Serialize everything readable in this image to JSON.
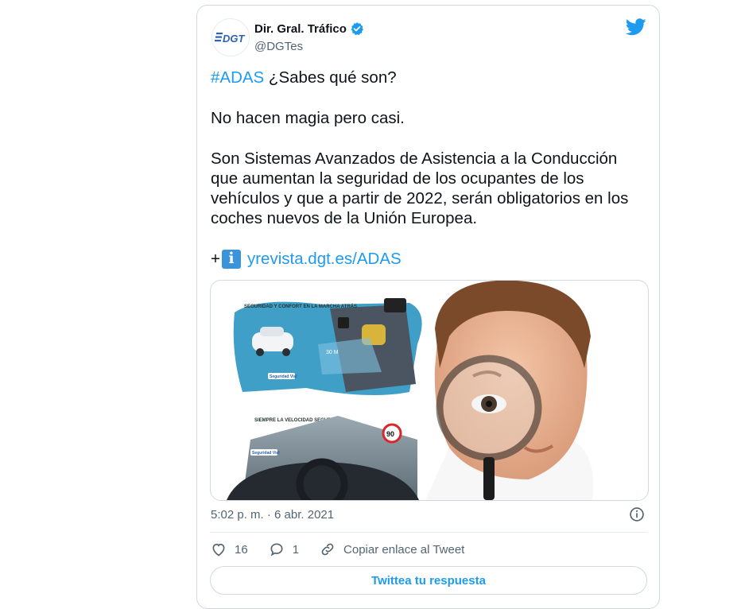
{
  "tweet": {
    "author_name": "Dir. Gral. Tráfico",
    "handle": "@DGTes",
    "avatar_logo_text": "DGT",
    "verified": true,
    "hashtag": "#ADAS",
    "line1_rest": " ¿Sabes qué son?",
    "line2": "No hacen magia pero casi.",
    "line3": "Son Sistemas Avanzados de Asistencia a la Conducción que aumentan la seguridad de los ocupantes de los vehículos y que a partir de 2022, serán obligatorios en los coches nuevos de la Unión Europea.",
    "plus": "+",
    "info_glyph": "i",
    "link": "yrevista.dgt.es/ADAS",
    "timestamp": "5:02 p. m. · 6 abr. 2021",
    "likes": "16",
    "replies": "1",
    "copy_link_label": "Copiar enlace al Tweet",
    "reply_button_label": "Twittea tu respuesta"
  },
  "media": {
    "infographic_headings": [
      "SEGURIDAD Y CONFORT EN LA MARCHA ATRÁS",
      "SIEMPRE LA VELOCIDAD SEGURA"
    ],
    "speed_sign": "90",
    "distance_label": "30 M",
    "brand_label": "Seguridad Vial"
  },
  "colors": {
    "link_blue": "#1d9bf0",
    "text": "#0f1419",
    "secondary": "#536471",
    "border": "#cfd9de"
  },
  "icons": {
    "brand": "twitter-bird-icon",
    "verified": "verified-badge-icon",
    "like": "heart-icon",
    "reply": "speech-bubble-icon",
    "copy_link": "link-icon",
    "info": "info-circle-icon"
  }
}
